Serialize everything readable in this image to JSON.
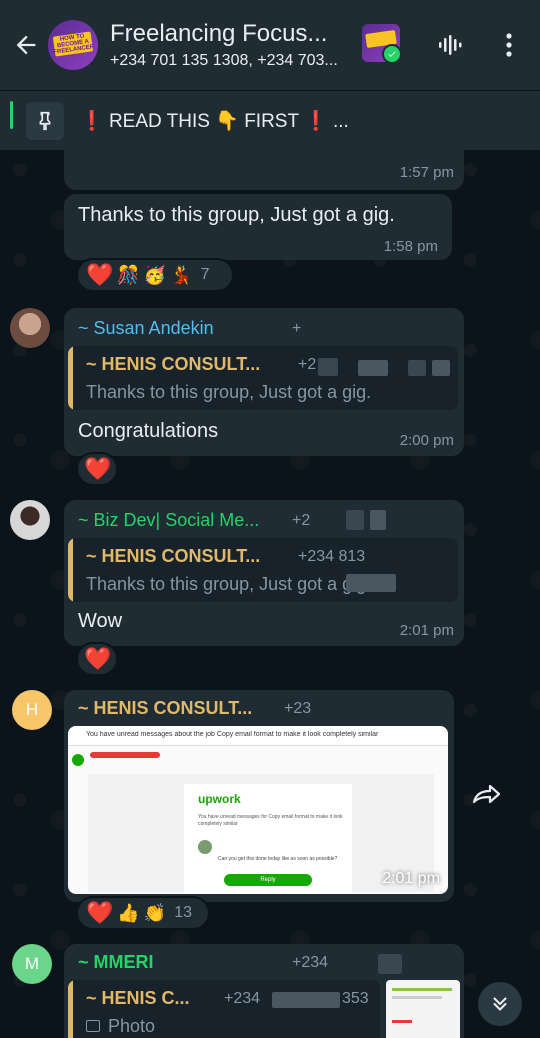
{
  "header": {
    "title": "Freelancing Focus...",
    "subtitle": "+234 701 135 1308, +234 703...",
    "avatar_text": "HOW TO BECOME A FREELANCER"
  },
  "pinned": {
    "exclaim_left": "❗",
    "text_a": "READ THIS",
    "hand": "👇",
    "text_b": "FIRST",
    "exclaim_right": "❗",
    "ellipsis": "..."
  },
  "messages": [
    {
      "time": "1:57 pm"
    },
    {
      "text": "Thanks to this group, Just got a gig.",
      "time": "1:58 pm",
      "reactions": [
        "❤️",
        "🎊",
        "🥳",
        "💃"
      ],
      "reaction_count": "7"
    },
    {
      "sender": "~ Susan Andekin",
      "sender_phone": "+",
      "quote_name": "~ HENIS CONSULT...",
      "quote_phone": "+2",
      "quote_text": "Thanks to this group, Just got a gig.",
      "text": "Congratulations",
      "time": "2:00 pm",
      "reactions": [
        "❤️"
      ]
    },
    {
      "sender": "~ Biz Dev| Social Me...",
      "sender_phone": "+2",
      "quote_name": "~ HENIS CONSULT...",
      "quote_phone": "+234 813",
      "quote_text": "Thanks to this group, Just got a gig.",
      "text": "Wow",
      "time": "2:01 pm",
      "reactions": [
        "❤️"
      ]
    },
    {
      "avatar_letter": "H",
      "sender": "~ HENIS CONSULT...",
      "sender_phone": "+23",
      "image": {
        "notice": "You have unread messages about the job Copy email format to make it look completely similar",
        "brand": "upwork",
        "body": "You have unread messages for Copy email format to make it look completely similar",
        "chat_line": "Can you get this done today like as soon as possible?",
        "reply_label": "Reply"
      },
      "time": "2:01 pm",
      "reactions": [
        "❤️",
        "👍",
        "👏"
      ],
      "reaction_count": "13"
    },
    {
      "avatar_letter": "M",
      "sender": "~ MMERI",
      "sender_phone": "+234",
      "quote_name": "~ HENIS C...",
      "quote_phone": "+234",
      "quote_phone_end": "353",
      "quote_text": "Photo"
    }
  ],
  "colors": {
    "header_bg": "#1f2c34",
    "chat_bg": "#0b141a",
    "bubble_bg": "#1f2c34",
    "susan_name": "#53bdeb",
    "bizdev_name": "#25d366",
    "henis_name": "#e0b86b",
    "mmeri_name": "#25d366",
    "avatar_h": "#f7c56a",
    "avatar_m": "#6bd589"
  }
}
